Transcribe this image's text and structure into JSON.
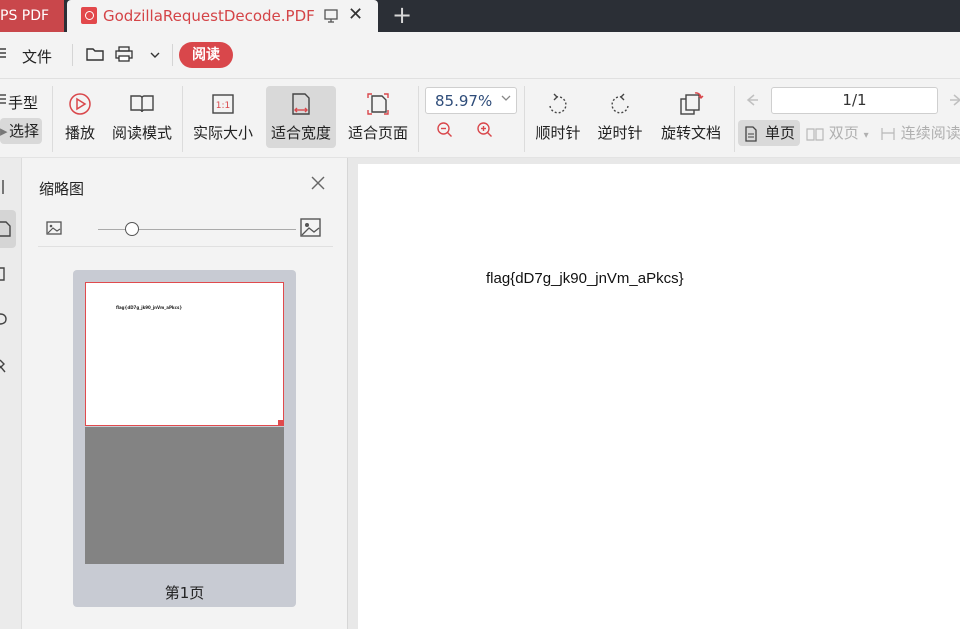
{
  "tabs": {
    "app_label": "PS PDF",
    "doc_title": "GodzillaRequestDecode.PDF",
    "close_glyph": "✕",
    "new_tab_glyph": "+"
  },
  "menubar": {
    "file_label": "文件",
    "read_label": "阅读"
  },
  "ribbon": {
    "hand_label": "手型",
    "select_label": "选择",
    "play_label": "播放",
    "read_mode_label": "阅读模式",
    "actual_size_label": "实际大小",
    "fit_width_label": "适合宽度",
    "fit_page_label": "适合页面",
    "zoom_value": "85.97%",
    "clockwise_label": "顺时针",
    "counterclockwise_label": "逆时针",
    "rotate_doc_label": "旋转文档",
    "page_value": "1/1",
    "single_page_label": "单页",
    "double_page_label": "双页",
    "continuous_label": "连续阅读"
  },
  "thumbnail_panel": {
    "title": "缩略图",
    "thumb_text": "flag{dD7g_jk90_jnVm_aPkcs}",
    "page_label": "第1页",
    "slider_level": 0.17
  },
  "document": {
    "text": "flag{dD7g_jk90_jnVm_aPkcs}"
  },
  "colors": {
    "accent": "#d9474b",
    "tabbar_bg": "#2b2f36"
  }
}
